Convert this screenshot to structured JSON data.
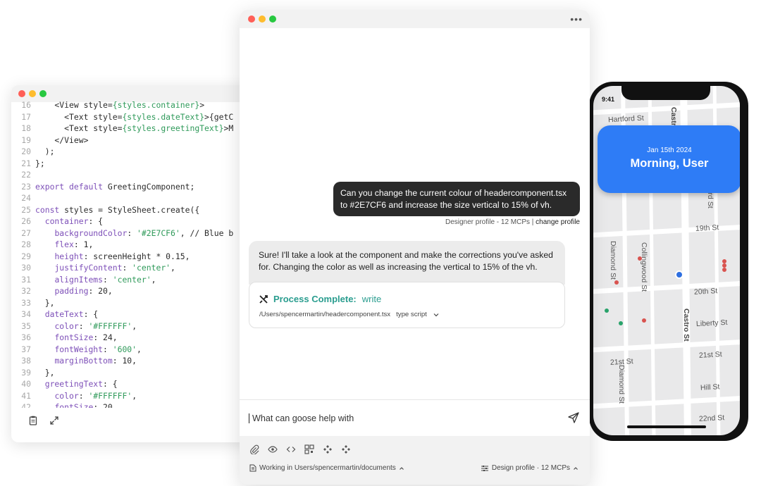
{
  "editor": {
    "lines": [
      {
        "n": "16",
        "t": "    <View style={styles.container}>"
      },
      {
        "n": "17",
        "t": "      <Text style={styles.dateText}>{getC"
      },
      {
        "n": "18",
        "t": "      <Text style={styles.greetingText}>M"
      },
      {
        "n": "19",
        "t": "    </View>"
      },
      {
        "n": "20",
        "t": "  );"
      },
      {
        "n": "21",
        "t": "};"
      },
      {
        "n": "22",
        "t": ""
      },
      {
        "n": "23",
        "t": "export default GreetingComponent;"
      },
      {
        "n": "24",
        "t": ""
      },
      {
        "n": "25",
        "t": "const styles = StyleSheet.create({"
      },
      {
        "n": "26",
        "t": "  container: {"
      },
      {
        "n": "27",
        "t": "    backgroundColor: '#2E7CF6', // Blue b"
      },
      {
        "n": "28",
        "t": "    flex: 1,"
      },
      {
        "n": "29",
        "t": "    height: screenHeight * 0.15,"
      },
      {
        "n": "30",
        "t": "    justifyContent: 'center',"
      },
      {
        "n": "31",
        "t": "    alignItems: 'center',"
      },
      {
        "n": "32",
        "t": "    padding: 20,"
      },
      {
        "n": "33",
        "t": "  },"
      },
      {
        "n": "34",
        "t": "  dateText: {"
      },
      {
        "n": "35",
        "t": "    color: '#FFFFFF',"
      },
      {
        "n": "36",
        "t": "    fontSize: 24,"
      },
      {
        "n": "37",
        "t": "    fontWeight: '600',"
      },
      {
        "n": "38",
        "t": "    marginBottom: 10,"
      },
      {
        "n": "39",
        "t": "  },"
      },
      {
        "n": "40",
        "t": "  greetingText: {"
      },
      {
        "n": "41",
        "t": "    color: '#FFFFFF',"
      },
      {
        "n": "42",
        "t": "    fontSize: 20,"
      }
    ],
    "footer_icons": [
      "clipboard-icon",
      "expand-icon"
    ]
  },
  "chat": {
    "user_message": "Can you change the current colour of headercomponent.tsx to #2E7CF6 and increase the size vertical to 15% of vh.",
    "user_meta_profile": "Designer profile - 12 MCPs | ",
    "user_meta_link": "change profile",
    "bot_message": "Sure! I'll take a look at the component and make the corrections you've asked for. Changing the color as well as increasing the vertical to 15% of the vh.",
    "process_title": "Process Complete:",
    "process_action": "write",
    "process_path": "/Users/spencermartin/headercomponent.tsx",
    "process_lang": "type script",
    "input_placeholder": "What can goose help with",
    "status_left": "Working in Users/spencermartin/documents",
    "status_right": "Design profile · 12 MCPs",
    "accent": "#2a9d8f"
  },
  "phone": {
    "time": "9:41",
    "date": "Jan 15th 2024",
    "greeting": "Morning, User",
    "card_color": "#2E7CF6",
    "streets": {
      "nineteenth": "19th St",
      "twentieth": "20th St",
      "liberty": "Liberty St",
      "twentyfirst_left": "21st St",
      "twentyfirst_right": "21st St",
      "hill": "Hill St",
      "twentysecond": "22nd St",
      "diamond_top": "Diamond St",
      "diamond_bottom": "Diamond St",
      "collingwood": "Collingwood St",
      "castro_top": "Castro St",
      "castro_bottom": "Castro St",
      "sanford": "Sanford St",
      "hartford": "Hartford St"
    }
  }
}
